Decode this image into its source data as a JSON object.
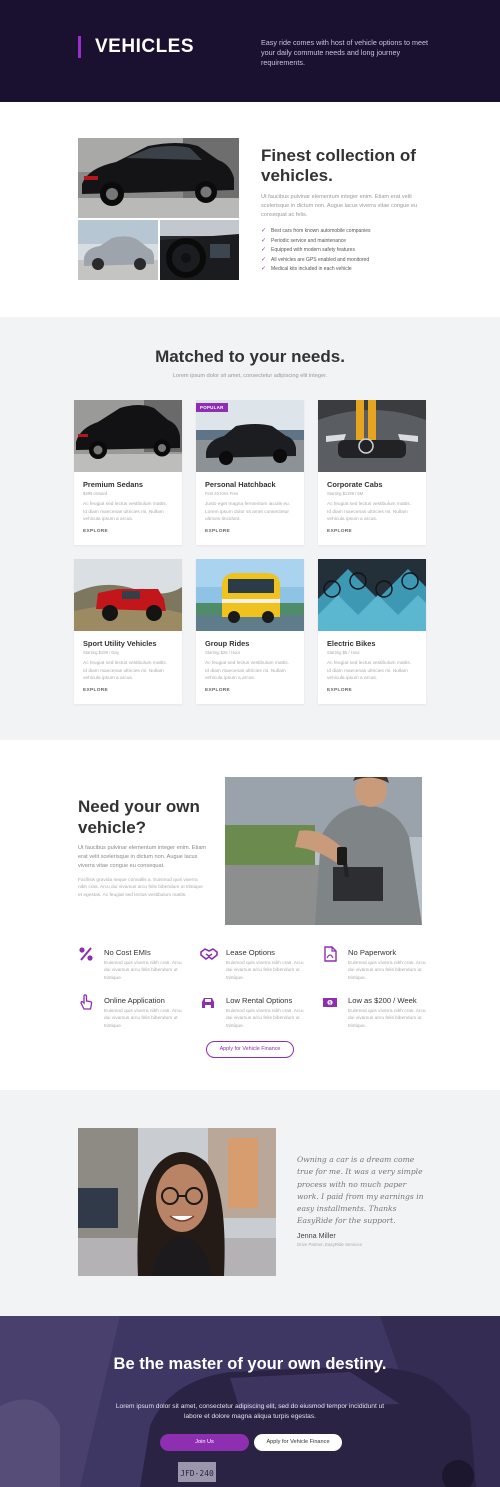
{
  "hero": {
    "title": "VEHICLES",
    "description": "Easy ride comes with host of vehicle options to meet your daily commute needs and long journey requirements."
  },
  "collection": {
    "heading": "Finest collection of vehicles.",
    "paragraph": "Ut faucibus pulvinar elementum integer enim. Etiam erat velit scelerisque in dictum non. Augue lacus viverra vitae congue eu consequat ac felis.",
    "checks": [
      "Best cars from known automobile companies",
      "Periodic service and maintenance",
      "Equipped with modern safety features",
      "All vehicles are GPS enabled and monitored",
      "Medical kits included in each vehicle"
    ]
  },
  "matched": {
    "heading": "Matched to your needs.",
    "subtitle": "Lorem ipsum dolor sit amet, consectetur adipiscing elit integer.",
    "cards": [
      {
        "title": "Premium Sedans",
        "price": "$499 onward",
        "text": "Ac feugiat sed lectus vestibulum mattis. Id diam maecenas ultricies mi. Nullam vehicula ipsum a arcus.",
        "link": "EXPLORE",
        "badge": ""
      },
      {
        "title": "Personal Hatchback",
        "price": "First 20 Kms Free",
        "text": "Justo eget magna fermentum iaculis eu. Lorem ipsum dolor sit amet consectetur ultrices tincidunt.",
        "link": "EXPLORE",
        "badge": "POPULAR"
      },
      {
        "title": "Corporate Cabs",
        "price": "Starting $1199 / 6M",
        "text": "Ac feugiat sed lectus vestibulum mattis. Id diam maecenas ultricies mi. Nullam vehicula ipsum a arcus.",
        "link": "EXPLORE",
        "badge": ""
      },
      {
        "title": "Sport Utility Vehicles",
        "price": "Starting $199 / Day",
        "text": "Ac feugiat sed lectus vestibulum mattis. Id diam maecenas ultricies mi. Nullam vehicula ipsum a arcus.",
        "link": "EXPLORE",
        "badge": ""
      },
      {
        "title": "Group Rides",
        "price": "Starting $26 / Hour",
        "text": "Ac feugiat sed lectus vestibulum mattis. Id diam maecenas ultricies mi. Nullam vehicula ipsum a arcus.",
        "link": "EXPLORE",
        "badge": ""
      },
      {
        "title": "Electric Bikes",
        "price": "Starting $5 / Hour",
        "text": "Ac feugiat sed lectus vestibulum mattis. Id diam maecenas ultricies mi. Nullam vehicula ipsum a arcus.",
        "link": "EXPLORE",
        "badge": ""
      }
    ]
  },
  "finance": {
    "heading": "Need your own vehicle?",
    "paragraph1": "Ut faucibus pulvinar elementum integer enim. Etiam erat velit scelerisque in dictum non. Augue lacus viverra vitae congue eu consequat.",
    "paragraph2": "Facilisis gravida neque convallis a. Euismod quis viverra nibh cras. Arcu dui vivamus arcu felis bibendum ut tristique et egestas. Ac feugiat sed lectus vestibulum mattis.",
    "features": [
      {
        "icon": "percent-icon",
        "title": "No Cost EMIs",
        "text": "Euismod quis viverra nibh cras. Arcu dui vivamus arcu felis bibendum ut tristique."
      },
      {
        "icon": "handshake-icon",
        "title": "Lease Options",
        "text": "Euismod quis viverra nibh cras. Arcu dui vivamus arcu felis bibendum ut tristique."
      },
      {
        "icon": "document-icon",
        "title": "No Paperwork",
        "text": "Euismod quis viverra nibh cras. Arcu dui vivamus arcu felis bibendum ut tristique."
      },
      {
        "icon": "pointer-hand-icon",
        "title": "Online Application",
        "text": "Euismod quis viverra nibh cras. Arcu dui vivamus arcu felis bibendum ut tristique."
      },
      {
        "icon": "car-icon",
        "title": "Low Rental Options",
        "text": "Euismod quis viverra nibh cras. Arcu dui vivamus arcu felis bibendum ut tristique."
      },
      {
        "icon": "money-icon",
        "title": "Low as $200 / Week",
        "text": "Euismod quis viverra nibh cras. Arcu dui vivamus arcu felis bibendum ut tristique."
      }
    ],
    "cta": "Apply for Vehicle Finance"
  },
  "testimonial": {
    "quote": "Owning a car is a dream come true for me. It was a very simple process with no much paper work. I paid from my earnings in easy installments. Thanks EasyRide for the support.",
    "name": "Jenna Miller",
    "role": "Drive Partner, EasyRide Services"
  },
  "footer_cta": {
    "heading": "Be the master of your own destiny.",
    "paragraph": "Lorem ipsum dolor sit amet, consectetur adipiscing elit, sed do eiusmod tempor incididunt ut labore et dolore magna aliqua turpis egestas.",
    "primary_button": "Join Us",
    "secondary_button": "Apply for Vehicle Finance"
  },
  "colors": {
    "hero_bg": "#1a1130",
    "accent": "#8d2fb0",
    "section_gray": "#f2f3f5"
  }
}
